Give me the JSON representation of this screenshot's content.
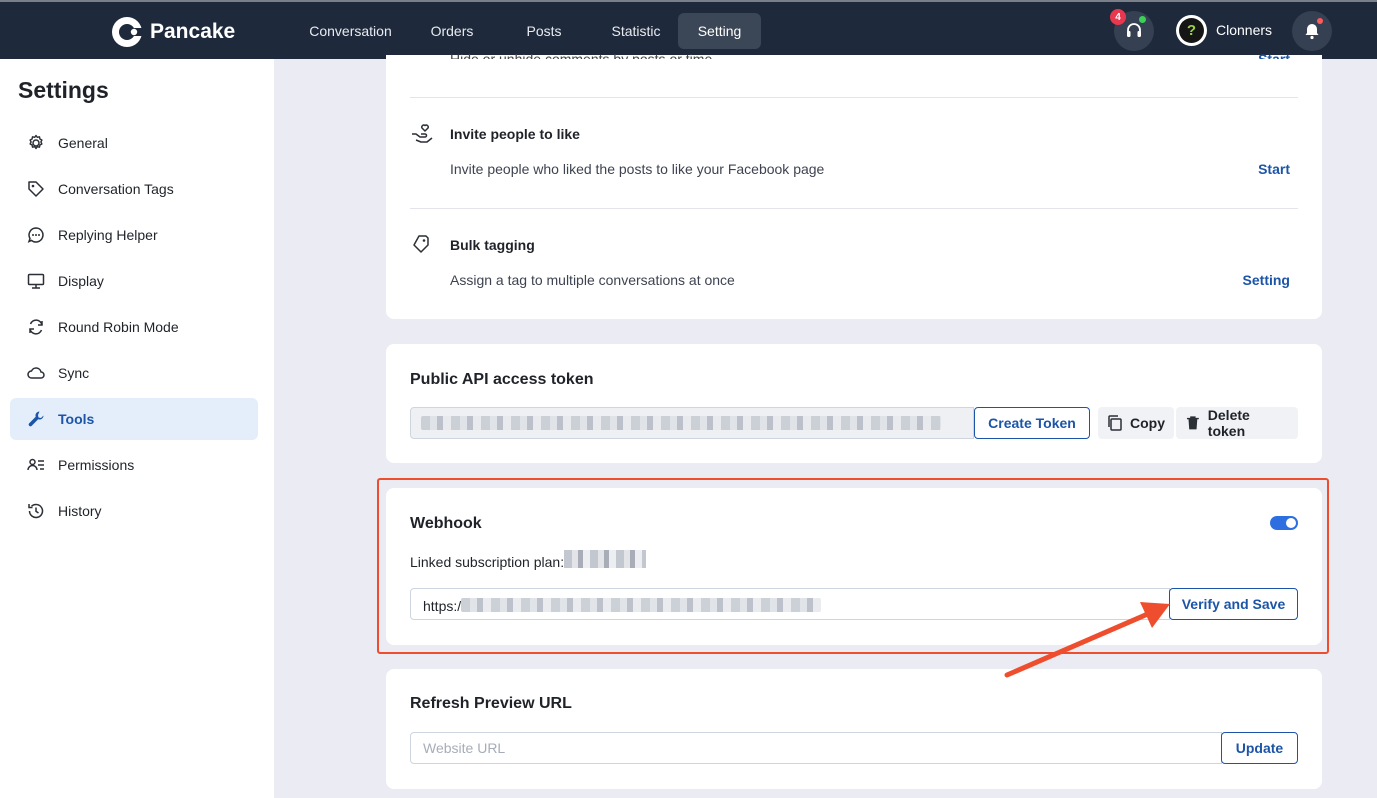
{
  "app": {
    "logo_text": "Pancake"
  },
  "nav": {
    "items": [
      "Conversation",
      "Orders",
      "Posts",
      "Statistic",
      "Setting"
    ],
    "active": "Setting"
  },
  "header": {
    "support_badge": "4",
    "username": "Clonners",
    "avatar_letter": "?"
  },
  "sidebar": {
    "title": "Settings",
    "items": [
      {
        "label": "General",
        "icon": "gear-icon"
      },
      {
        "label": "Conversation Tags",
        "icon": "tag-icon"
      },
      {
        "label": "Replying Helper",
        "icon": "chat-bubble-icon"
      },
      {
        "label": "Display",
        "icon": "monitor-icon"
      },
      {
        "label": "Round Robin Mode",
        "icon": "refresh-icon"
      },
      {
        "label": "Sync",
        "icon": "cloud-icon"
      },
      {
        "label": "Tools",
        "icon": "wrench-icon",
        "active": true
      },
      {
        "label": "Permissions",
        "icon": "user-list-icon"
      },
      {
        "label": "History",
        "icon": "history-icon"
      }
    ]
  },
  "tools": {
    "partial_desc": "Hide or unhide comments by posts or time",
    "partial_link": "Start",
    "invite": {
      "title": "Invite people to like",
      "desc": "Invite people who liked the posts to like your Facebook page",
      "link": "Start"
    },
    "bulk": {
      "title": "Bulk tagging",
      "desc": "Assign a tag to multiple conversations at once",
      "link": "Setting"
    }
  },
  "api_token": {
    "title": "Public API access token",
    "create_label": "Create Token",
    "copy_label": "Copy",
    "delete_label": "Delete token"
  },
  "webhook": {
    "title": "Webhook",
    "enabled": true,
    "plan_label": "Linked subscription plan:",
    "url_prefix": "https:/",
    "verify_label": "Verify and Save"
  },
  "refresh_preview": {
    "title": "Refresh Preview URL",
    "placeholder": "Website URL",
    "update_label": "Update"
  },
  "colors": {
    "topbar": "#1e2a3b",
    "accent": "#1c55a8",
    "highlight": "#ee4e2e",
    "toggle": "#2d6ee0"
  }
}
